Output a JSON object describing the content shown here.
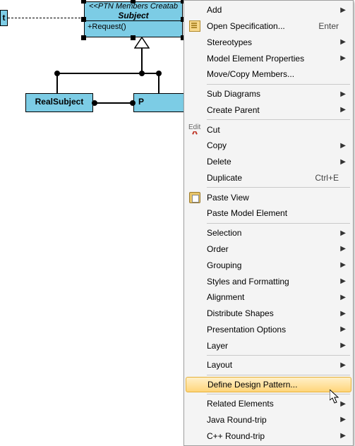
{
  "diagram": {
    "subject": {
      "stereotype": "<<PTN Members Creatab",
      "name": "Subject",
      "operation": "+Request()"
    },
    "real_subject": {
      "name": "RealSubject"
    },
    "proxy_partial": {
      "name_fragment": "P"
    },
    "left_partial": {
      "name_fragment": "t"
    }
  },
  "menu": {
    "groups": {
      "edit": "Edit"
    },
    "items": [
      {
        "id": "add",
        "label": "Add",
        "submenu": true
      },
      {
        "id": "open-spec",
        "label": "Open Specification...",
        "shortcut": "Enter",
        "icon": "spec"
      },
      {
        "id": "stereotypes",
        "label": "Stereotypes",
        "submenu": true
      },
      {
        "id": "model-props",
        "label": "Model Element Properties",
        "submenu": true
      },
      {
        "id": "move-copy",
        "label": "Move/Copy Members..."
      },
      {
        "id": "sub-diagrams",
        "label": "Sub Diagrams",
        "submenu": true
      },
      {
        "id": "create-parent",
        "label": "Create Parent",
        "submenu": true
      },
      {
        "id": "cut",
        "label": "Cut",
        "icon": "cut"
      },
      {
        "id": "copy",
        "label": "Copy",
        "submenu": true
      },
      {
        "id": "delete",
        "label": "Delete",
        "submenu": true
      },
      {
        "id": "duplicate",
        "label": "Duplicate",
        "shortcut": "Ctrl+E"
      },
      {
        "id": "paste-view",
        "label": "Paste View",
        "icon": "paste"
      },
      {
        "id": "paste-model",
        "label": "Paste Model Element"
      },
      {
        "id": "selection",
        "label": "Selection",
        "submenu": true
      },
      {
        "id": "order",
        "label": "Order",
        "submenu": true
      },
      {
        "id": "grouping",
        "label": "Grouping",
        "submenu": true
      },
      {
        "id": "styles-fmt",
        "label": "Styles and Formatting",
        "submenu": true
      },
      {
        "id": "alignment",
        "label": "Alignment",
        "submenu": true
      },
      {
        "id": "distribute",
        "label": "Distribute Shapes",
        "submenu": true
      },
      {
        "id": "pres-options",
        "label": "Presentation Options",
        "submenu": true
      },
      {
        "id": "layer",
        "label": "Layer",
        "submenu": true
      },
      {
        "id": "layout",
        "label": "Layout",
        "submenu": true
      },
      {
        "id": "define-pattern",
        "label": "Define Design Pattern...",
        "highlight": true
      },
      {
        "id": "related",
        "label": "Related Elements",
        "submenu": true
      },
      {
        "id": "java-rt",
        "label": "Java Round-trip",
        "submenu": true
      },
      {
        "id": "cpp-rt",
        "label": "C++ Round-trip",
        "submenu": true
      }
    ],
    "separators_after": [
      "move-copy",
      "create-parent",
      "duplicate",
      "paste-model",
      "layer",
      "layout",
      "define-pattern"
    ]
  }
}
